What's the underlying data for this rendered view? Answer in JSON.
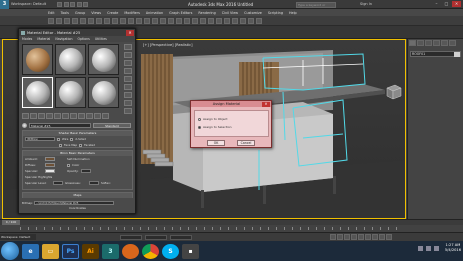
{
  "window": {
    "workspace": "Workspace: Default",
    "title": "Autodesk 3ds Max 2016   Untitled",
    "search_placeholder": "Type a keyword or phrase",
    "sign_in": "Sign In",
    "minimize": "–",
    "maximize": "□",
    "close": "✕"
  },
  "menubar": [
    "Edit",
    "Tools",
    "Group",
    "Views",
    "Create",
    "Modifiers",
    "Animation",
    "Graph Editors",
    "Rendering",
    "Civil View",
    "Customize",
    "Scripting",
    "Help"
  ],
  "viewport": {
    "label": "[+] [Perspective] [Realistic]",
    "border_color": "#f0c000"
  },
  "material_editor": {
    "title": "Material Editor - Material #25",
    "close": "✕",
    "menu": [
      "Modes",
      "Material",
      "Navigation",
      "Options",
      "Utilities"
    ],
    "slots": [
      {
        "type": "wood",
        "active": false
      },
      {
        "type": "grey",
        "active": false
      },
      {
        "type": "grey",
        "active": false
      },
      {
        "type": "grey",
        "active": true
      },
      {
        "type": "grey",
        "active": false
      },
      {
        "type": "grey",
        "active": false
      }
    ],
    "material_name": "Material #25",
    "type_button": "Standard",
    "shader_rollout": {
      "header": "Shader Basic Parameters",
      "shader": "(B)Blinn",
      "options": [
        "Wire",
        "2-Sided",
        "Face Map",
        "Faceted"
      ]
    },
    "blinn_rollout": {
      "header": "Blinn Basic Parameters",
      "self_illumination": "Self-Illumination",
      "ambient": "Ambient:",
      "diffuse": "Diffuse:",
      "specular": "Specular:",
      "color_label": "Color",
      "opacity": "Opacity:",
      "specular_highlights": "Specular Highlights",
      "spec_level": "Specular Level:",
      "glossiness": "Glossiness:",
      "soften": "Soften:"
    },
    "extended_header": "Extended Parameters",
    "supersampling_header": "SuperSampling",
    "maps_header": "Maps",
    "bitmap_label": "Bitmap:",
    "bitmap_path": "...\\Arch\\4 Ext\\Wood\\Material #25",
    "bitmap_params_header": "Bitmap Parameters",
    "coordinates_header": "Coordinates"
  },
  "assign_dialog": {
    "title": "Assign Material",
    "close": "✕",
    "option_1": "Assign to Object",
    "option_2": "Assign to Selection",
    "ok": "OK",
    "cancel": "Cancel"
  },
  "command_panel": {
    "object_name": "ROOF01"
  },
  "timeslider": {
    "frame": "0 / 100"
  },
  "status": {
    "workspace": "Workspace: Default"
  },
  "taskbar": {
    "apps": [
      {
        "id": "tb-ie",
        "icon": "internet-explorer-icon",
        "glyph": "e"
      },
      {
        "id": "tb-folder",
        "icon": "folder-icon",
        "glyph": "▭"
      },
      {
        "id": "tb-ps",
        "icon": "photoshop-icon",
        "glyph": "Ps"
      },
      {
        "id": "tb-ai",
        "icon": "illustrator-icon",
        "glyph": "Ai"
      },
      {
        "id": "tb-max",
        "icon": "3ds-max-icon",
        "glyph": "3"
      },
      {
        "id": "tb-ff",
        "icon": "firefox-icon",
        "glyph": ""
      },
      {
        "id": "tb-chrome",
        "icon": "chrome-icon",
        "glyph": ""
      },
      {
        "id": "tb-skype",
        "icon": "skype-icon",
        "glyph": "S"
      },
      {
        "id": "tb-misc",
        "icon": "app-icon",
        "glyph": "▪"
      }
    ],
    "time": "1:27 AM",
    "date": "5/4/2016"
  }
}
